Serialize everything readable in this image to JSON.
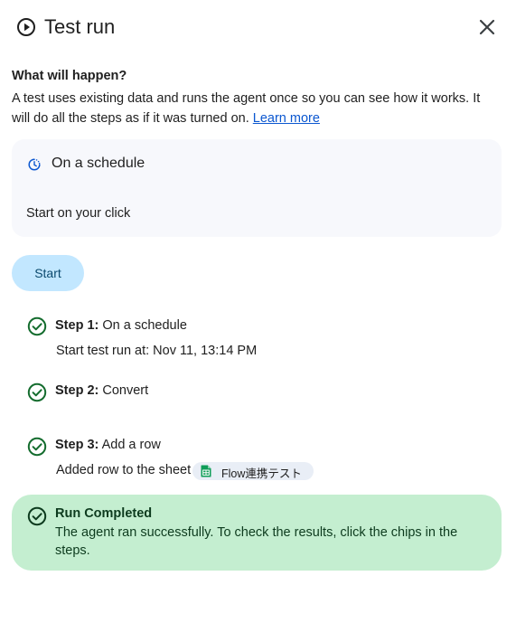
{
  "header": {
    "title": "Test run"
  },
  "intro": {
    "heading": "What will happen?",
    "description": "A test uses existing data and runs the agent once so you can see how it works. It will do all the steps as if it was turned on.",
    "learn_more": "Learn more"
  },
  "trigger": {
    "label": "On a schedule",
    "sub": "Start on your click"
  },
  "start_button": "Start",
  "steps": [
    {
      "prefix": "Step 1:",
      "name": "On a schedule",
      "detail": "Start test run at: Nov 11, 13:14 PM"
    },
    {
      "prefix": "Step 2:",
      "name": "Convert"
    },
    {
      "prefix": "Step 3:",
      "name": "Add a row",
      "detail": "Added row to the sheet",
      "chip": "Flow連携テスト"
    }
  ],
  "completion": {
    "title": "Run Completed",
    "message": "The agent ran successfully. To check the results, click the chips in the steps."
  },
  "colors": {
    "accent_blue": "#0b57d0",
    "start_button_bg": "#c2e7ff",
    "success_green": "#146c2e",
    "completion_bg": "#c4eed0",
    "sheets_green": "#0f9d58"
  },
  "icons": {
    "title": "play-circle-icon",
    "close": "close-icon",
    "trigger": "schedule-icon",
    "step_status": "check-circle-icon",
    "chip": "google-sheets-icon"
  }
}
